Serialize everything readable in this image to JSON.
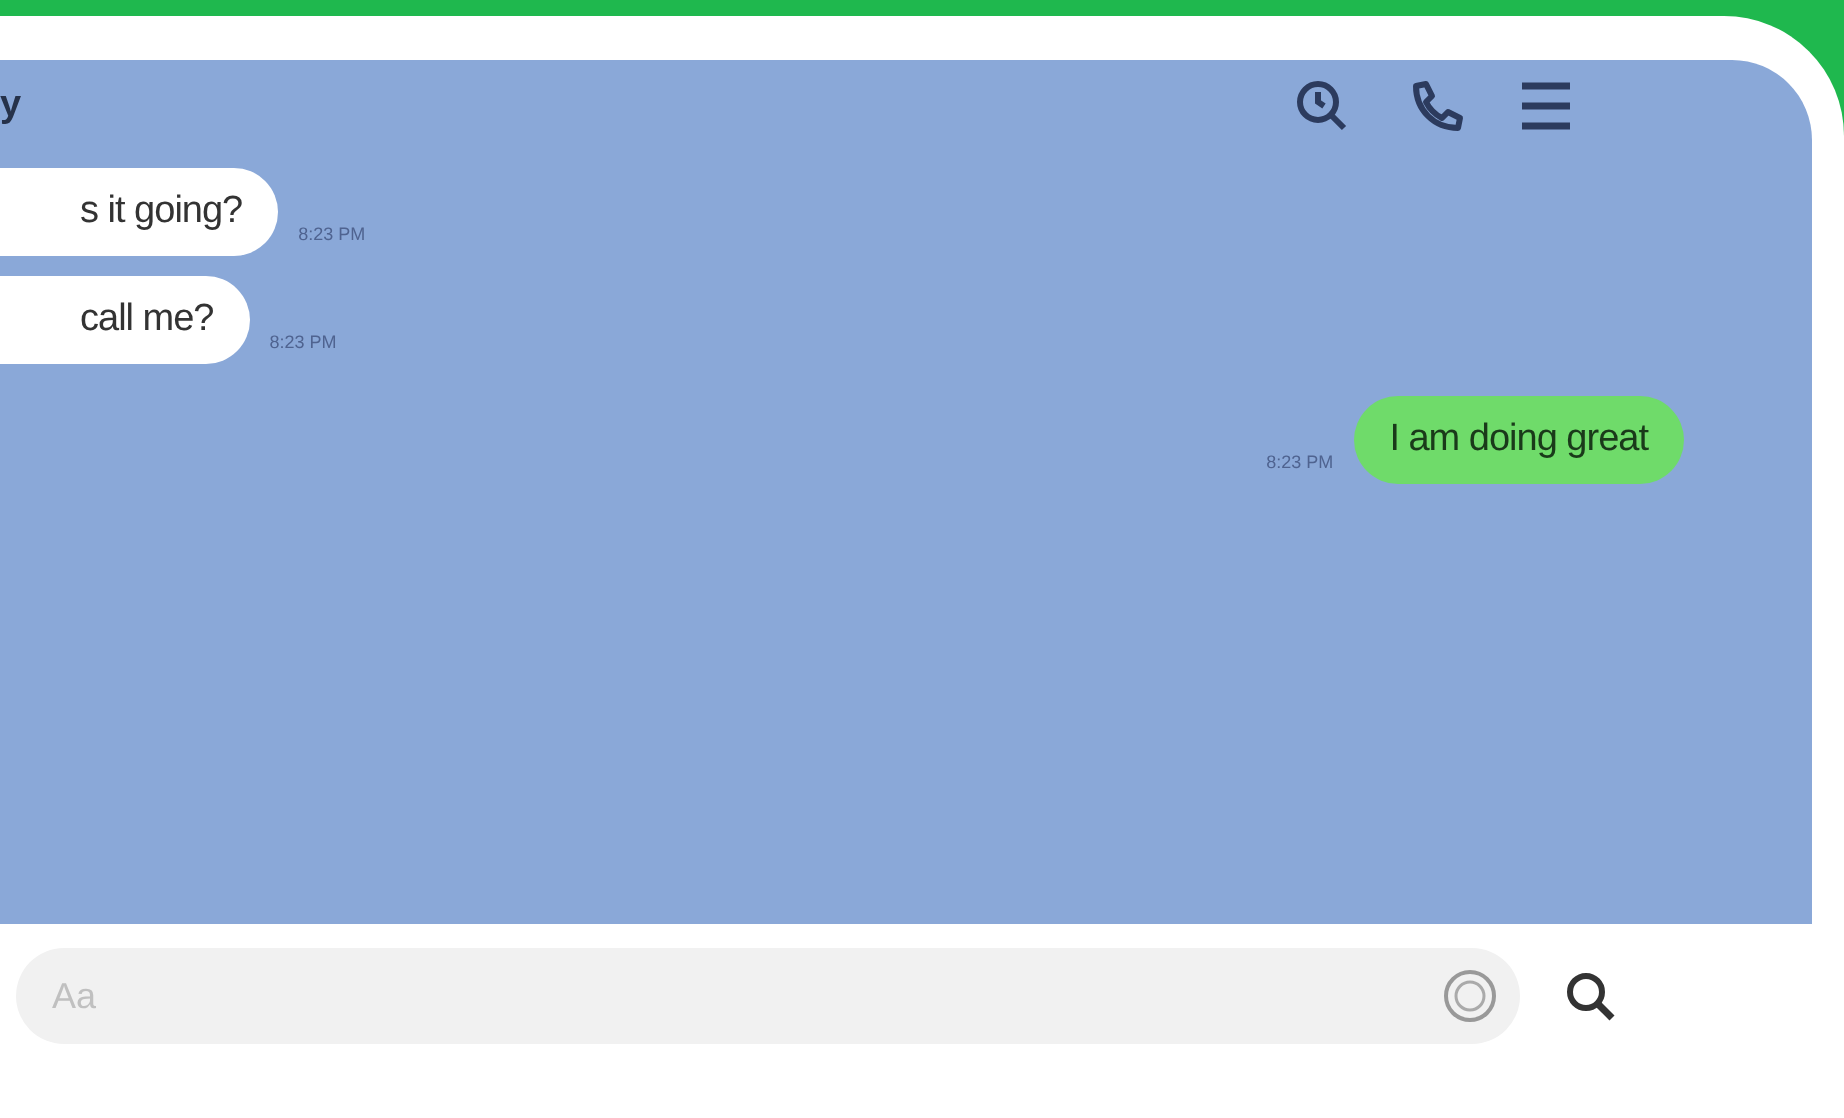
{
  "chat": {
    "title": "y",
    "messages": [
      {
        "kind": "incoming",
        "text": "s it going?",
        "time": "8:23 PM"
      },
      {
        "kind": "incoming",
        "text": "call me?",
        "time": "8:23 PM"
      },
      {
        "kind": "outgoing",
        "text": "I am doing great",
        "time": "8:23 PM"
      }
    ]
  },
  "composer": {
    "placeholder": "Aa"
  }
}
